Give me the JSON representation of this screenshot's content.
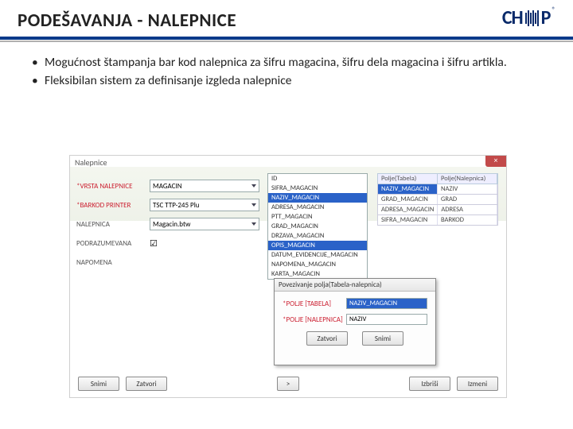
{
  "title": "PODEŠAVANJA - NALEPNICE",
  "logo": {
    "part1": "CH",
    "part2": "P",
    "reg": "®"
  },
  "bullets": [
    "Mogućnost štampanja bar kod nalepnica za šifru magacina, šifru dela magacina i šifru artikla.",
    "Fleksibilan sistem za definisanje izgleda nalepnice"
  ],
  "window": {
    "title": "Nalepnice",
    "close": "×",
    "form": [
      {
        "label": "*VRSTA NALEPNICE",
        "req": true,
        "type": "select",
        "value": "MAGACIN"
      },
      {
        "label": "*BARKOD PRINTER",
        "req": true,
        "type": "select",
        "value": "TSC TTP-245 Plu"
      },
      {
        "label": "NALEPNICA",
        "req": false,
        "type": "select",
        "value": "Magacin.btw"
      },
      {
        "label": "PODRAZUMEVANA",
        "req": false,
        "type": "check",
        "value": "☑"
      },
      {
        "label": "NAPOMENA",
        "req": false,
        "type": "text",
        "value": ""
      }
    ],
    "list": [
      "ID",
      "SIFRA_MAGACIN",
      "NAZIV_MAGACIN",
      "ADRESA_MAGACIN",
      "PTT_MAGACIN",
      "GRAD_MAGACIN",
      "DRZAVA_MAGACIN",
      "OPIS_MAGACIN",
      "DATUM_EVIDENCIJE_MAGACIN",
      "NAPOMENA_MAGACIN",
      "KARTA_MAGACIN"
    ],
    "list_selected_index": 7,
    "pairs": {
      "head": [
        "Polje(Tabela)",
        "Polje(Nalepnica)"
      ],
      "rows": [
        [
          "NAZIV_MAGACIN",
          "NAZIV"
        ],
        [
          "GRAD_MAGACIN",
          "GRAD"
        ],
        [
          "ADRESA_MAGACIN",
          "ADRESA"
        ],
        [
          "SIFRA_MAGACIN",
          "BARKOD"
        ]
      ],
      "highlight_index": 0
    },
    "dialog": {
      "title": "Povezivanje polja(Tabela-nalepnica)",
      "rows": [
        {
          "label": "*POLJE [TABELA]",
          "value": "NAZIV_MAGACIN",
          "sel": true
        },
        {
          "label": "*POLJE [NALEPNICA]",
          "value": "NAZIV",
          "sel": false
        }
      ],
      "buttons": [
        "Zatvori",
        "Snimi"
      ]
    },
    "bottom_buttons_left": [
      "Snimi",
      "Zatvori"
    ],
    "bottom_buttons_right": [
      "Izbriši",
      "Izmeni"
    ],
    "bottom_middle": ">"
  }
}
